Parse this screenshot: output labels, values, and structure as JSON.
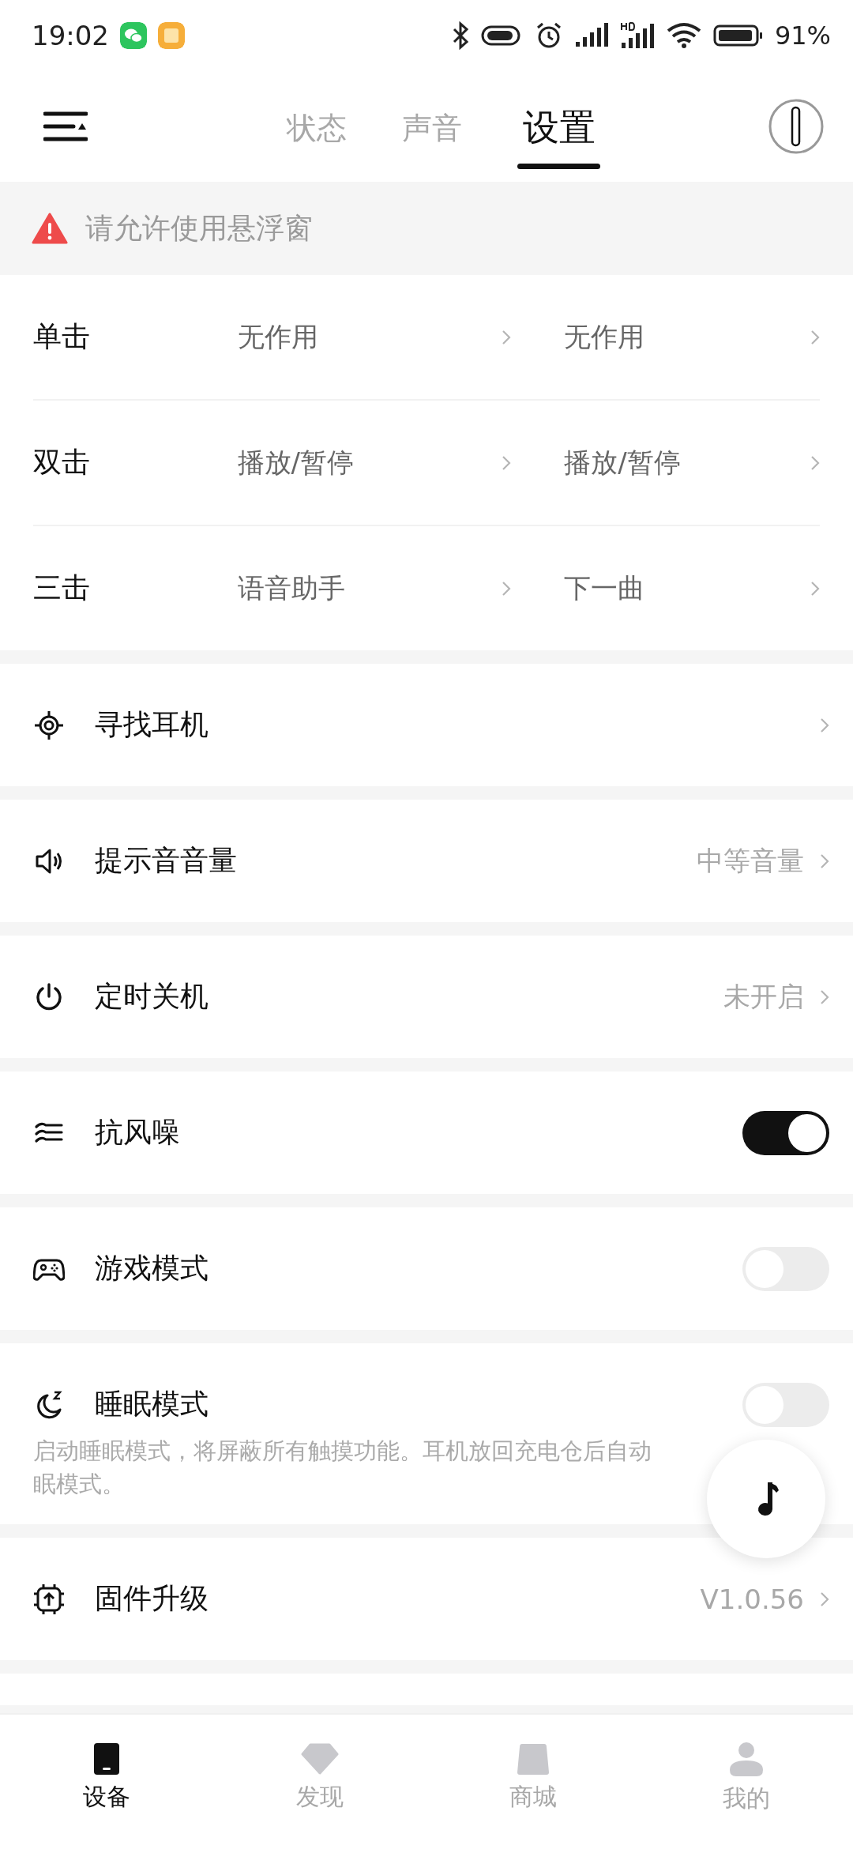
{
  "status_bar": {
    "time": "19:02",
    "battery": "91%"
  },
  "tabs": [
    {
      "label": "状态",
      "selected": false
    },
    {
      "label": "声音",
      "selected": false
    },
    {
      "label": "设置",
      "selected": true
    }
  ],
  "banner": {
    "text": "请允许使用悬浮窗"
  },
  "gestures": [
    {
      "label": "单击",
      "left": "无作用",
      "right": "无作用"
    },
    {
      "label": "双击",
      "left": "播放/暂停",
      "right": "播放/暂停"
    },
    {
      "label": "三击",
      "left": "语音助手",
      "right": "下一曲"
    }
  ],
  "settings": [
    {
      "kind": "link",
      "label": "寻找耳机"
    },
    {
      "kind": "link",
      "label": "提示音音量",
      "value": "中等音量"
    },
    {
      "kind": "link",
      "label": "定时关机",
      "value": "未开启"
    },
    {
      "kind": "toggle",
      "label": "抗风噪",
      "on": true
    },
    {
      "kind": "toggle",
      "label": "游戏模式",
      "on": false
    },
    {
      "kind": "toggle",
      "label": "睡眠模式",
      "on": false,
      "description_lines": [
        "启动睡眠模式，将屏蔽所有触摸功能。耳机放回充电仓后自动",
        "眠模式。"
      ]
    },
    {
      "kind": "link",
      "label": "固件升级",
      "value": "V1.0.56"
    }
  ],
  "bottom_nav": [
    {
      "label": "设备",
      "selected": true
    },
    {
      "label": "发现",
      "selected": false
    },
    {
      "label": "商城",
      "selected": false
    },
    {
      "label": "我的",
      "selected": false
    }
  ]
}
